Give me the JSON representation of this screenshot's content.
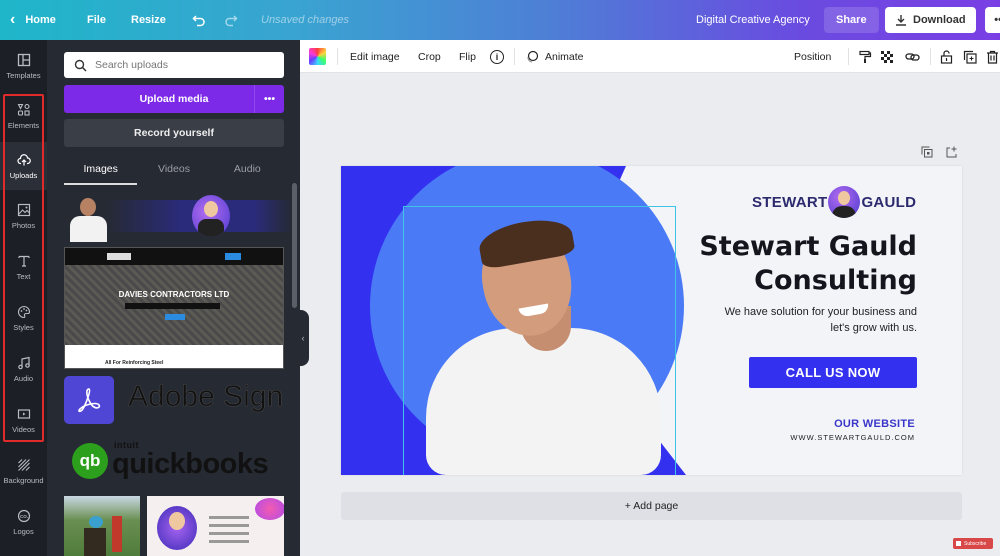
{
  "topbar": {
    "home_label": "Home",
    "file_label": "File",
    "resize_label": "Resize",
    "status": "Unsaved changes",
    "design_title": "Digital Creative Agency",
    "share_label": "Share",
    "download_label": "Download",
    "more_label": "•••"
  },
  "sidebar": {
    "items": [
      {
        "label": "Templates",
        "icon": "templates-icon"
      },
      {
        "label": "Elements",
        "icon": "elements-icon"
      },
      {
        "label": "Uploads",
        "icon": "upload-cloud-icon"
      },
      {
        "label": "Photos",
        "icon": "photo-icon"
      },
      {
        "label": "Text",
        "icon": "text-icon"
      },
      {
        "label": "Styles",
        "icon": "palette-icon"
      },
      {
        "label": "Audio",
        "icon": "music-note-icon"
      },
      {
        "label": "Videos",
        "icon": "video-icon"
      },
      {
        "label": "Background",
        "icon": "background-icon"
      },
      {
        "label": "Logos",
        "icon": "logos-icon"
      }
    ],
    "active": "Uploads"
  },
  "panel": {
    "search_placeholder": "Search uploads",
    "upload_label": "Upload media",
    "upload_more": "•••",
    "record_label": "Record yourself",
    "tabs": [
      "Images",
      "Videos",
      "Audio"
    ],
    "active_tab": "Images",
    "thumbs": {
      "davies_title": "DAVIES CONTRACTORS LTD",
      "davies_sub": "All For Reinforcing Steel",
      "adobe_text": "Adobe Sign",
      "qb_small": "intuit",
      "qb_text": "quickbooks"
    }
  },
  "toolbar": {
    "edit_image": "Edit image",
    "crop": "Crop",
    "flip": "Flip",
    "info": "i",
    "animate": "Animate",
    "position": "Position"
  },
  "design": {
    "logo_left": "STEWART",
    "logo_right": "GAULD",
    "headline_1": "Stewart Gauld",
    "headline_2": "Consulting",
    "tagline_1": "We have solution for your business and",
    "tagline_2": "let's grow with us.",
    "cta": "CALL US NOW",
    "website_label": "OUR WEBSITE",
    "website_url": "WWW.STEWARTGAULD.COM",
    "colors": {
      "primary": "#3330f0",
      "circle": "#4a7af5",
      "text": "#15151e",
      "website": "#3a36c9"
    }
  },
  "canvas": {
    "add_page": "+ Add page"
  },
  "overlay": {
    "subscribe": "Subscribe"
  }
}
